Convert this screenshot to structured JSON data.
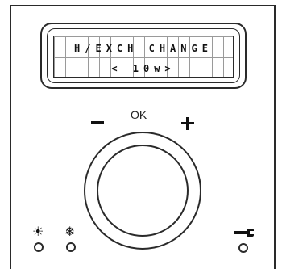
{
  "display": {
    "line1": "H/EXCH CHANGE",
    "line2": "< 10w>"
  },
  "controls": {
    "ok_label": "OK",
    "minus_label": "−",
    "plus_label": "+",
    "sun_symbol": "☀",
    "snow_symbol": "❄"
  },
  "icons": {
    "left_mode_icon": "sun-icon",
    "middle_mode_icon": "snowflake-icon",
    "right_mode_icon": "wrench-icon"
  }
}
